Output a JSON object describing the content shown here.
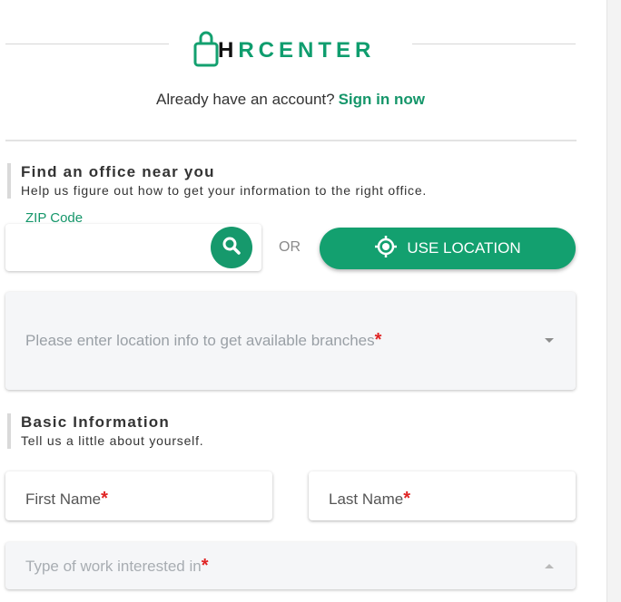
{
  "header": {
    "logo_text_part1": "H",
    "logo_text_part2": "RCENTER",
    "account_prompt": "Already have an account?",
    "signin_link": "Sign in now"
  },
  "office_section": {
    "title": "Find an office near you",
    "subtitle": "Help us figure out how to get your information to the right office.",
    "zip_label": "ZIP Code",
    "zip_value": "",
    "or_text": "OR",
    "use_location_label": "USE LOCATION",
    "branch_placeholder": "Please enter location info to get available branches",
    "required_mark": "*"
  },
  "basic_section": {
    "title": "Basic Information",
    "subtitle": "Tell us a little about yourself.",
    "first_name_label": "First Name",
    "last_name_label": "Last Name",
    "work_type_placeholder": "Type of work interested in",
    "required_mark": "*"
  },
  "colors": {
    "brand": "#13a06f",
    "required": "#e02424"
  }
}
